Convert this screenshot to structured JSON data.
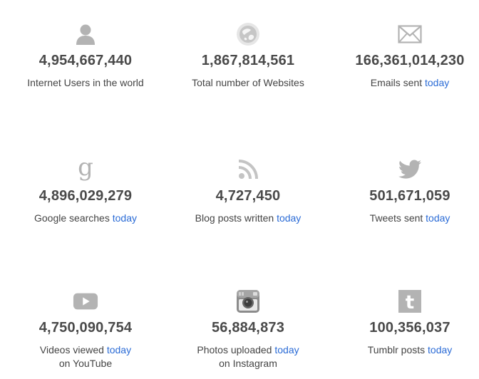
{
  "stats": [
    {
      "count": "4,954,667,440",
      "label": "Internet Users in the world",
      "today": "",
      "label2": "",
      "icon": "user-icon"
    },
    {
      "count": "1,867,814,561",
      "label": "Total number of Websites",
      "today": "",
      "label2": "",
      "icon": "globe-icon"
    },
    {
      "count": "166,361,014,230",
      "label": "Emails sent ",
      "today": "today",
      "label2": "",
      "icon": "envelope-icon"
    },
    {
      "count": "4,896,029,279",
      "label": "Google searches ",
      "today": "today",
      "label2": "",
      "icon": "google-icon"
    },
    {
      "count": "4,727,450",
      "label": "Blog posts written ",
      "today": "today",
      "label2": "",
      "icon": "rss-icon"
    },
    {
      "count": "501,671,059",
      "label": "Tweets sent ",
      "today": "today",
      "label2": "",
      "icon": "twitter-icon"
    },
    {
      "count": "4,750,090,754",
      "label": "Videos viewed ",
      "today": "today",
      "label2": "on YouTube",
      "icon": "youtube-icon"
    },
    {
      "count": "56,884,873",
      "label": "Photos uploaded ",
      "today": "today",
      "label2": "on Instagram",
      "icon": "instagram-icon"
    },
    {
      "count": "100,356,037",
      "label": "Tumblr posts ",
      "today": "today",
      "label2": "",
      "icon": "tumblr-icon"
    }
  ],
  "colors": {
    "icon": "#b3b3b3",
    "count": "#4a4a4a",
    "label": "#444444",
    "link": "#2a6bd6"
  }
}
